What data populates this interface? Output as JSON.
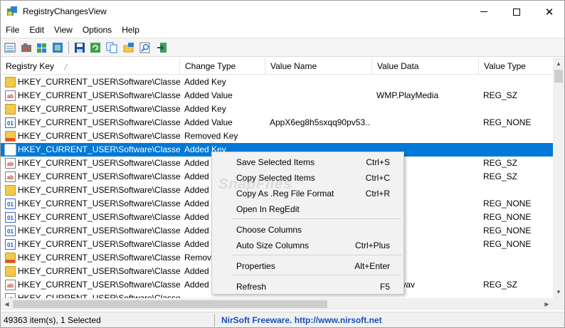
{
  "window": {
    "title": "RegistryChangesView"
  },
  "menu": [
    "File",
    "Edit",
    "View",
    "Options",
    "Help"
  ],
  "toolbar_icons": [
    "report-icon",
    "camera-icon",
    "snapshot-icon",
    "compare-icon",
    "save-icon",
    "refresh-icon",
    "copy-icon",
    "export-reg-icon",
    "find-icon",
    "exit-icon"
  ],
  "columns": [
    "Registry Key",
    "Change Type",
    "Value Name",
    "Value Data",
    "Value Type"
  ],
  "rows": [
    {
      "icon": "folder",
      "key": "HKEY_CURRENT_USER\\Software\\Classes\\...",
      "type": "Added Key",
      "name": "",
      "data": "",
      "vtype": ""
    },
    {
      "icon": "ab",
      "key": "HKEY_CURRENT_USER\\Software\\Classes\\...",
      "type": "Added Value",
      "name": "",
      "data": "WMP.PlayMedia",
      "vtype": "REG_SZ"
    },
    {
      "icon": "folder",
      "key": "HKEY_CURRENT_USER\\Software\\Classes\\...",
      "type": "Added Key",
      "name": "",
      "data": "",
      "vtype": ""
    },
    {
      "icon": "bin",
      "key": "HKEY_CURRENT_USER\\Software\\Classes\\...",
      "type": "Added Value",
      "name": "AppX6eg8h5sxqq90pv53...",
      "data": "",
      "vtype": "REG_NONE"
    },
    {
      "icon": "folder-removed",
      "key": "HKEY_CURRENT_USER\\Software\\Classes\\...",
      "type": "Removed Key",
      "name": "",
      "data": "",
      "vtype": ""
    },
    {
      "icon": "selected",
      "key": "HKEY_CURRENT_USER\\Software\\Classes\\...",
      "type": "Added Key",
      "name": "",
      "data": "",
      "vtype": "",
      "selected": true
    },
    {
      "icon": "ab",
      "key": "HKEY_CURRENT_USER\\Software\\Classes\\...",
      "type": "Added",
      "name": "",
      "data": "",
      "vtype": "REG_SZ"
    },
    {
      "icon": "ab",
      "key": "HKEY_CURRENT_USER\\Software\\Classes\\...",
      "type": "Added",
      "name": "",
      "data": "",
      "vtype": "REG_SZ"
    },
    {
      "icon": "folder",
      "key": "HKEY_CURRENT_USER\\Software\\Classes\\...",
      "type": "Added",
      "name": "",
      "data": "",
      "vtype": ""
    },
    {
      "icon": "bin",
      "key": "HKEY_CURRENT_USER\\Software\\Classes\\...",
      "type": "Added",
      "name": "",
      "data": "",
      "vtype": "REG_NONE"
    },
    {
      "icon": "bin",
      "key": "HKEY_CURRENT_USER\\Software\\Classes\\...",
      "type": "Added",
      "name": "",
      "data": "",
      "vtype": "REG_NONE"
    },
    {
      "icon": "bin",
      "key": "HKEY_CURRENT_USER\\Software\\Classes\\...",
      "type": "Added",
      "name": "",
      "data": "",
      "vtype": "REG_NONE"
    },
    {
      "icon": "bin",
      "key": "HKEY_CURRENT_USER\\Software\\Classes\\...",
      "type": "Added",
      "name": "",
      "data": "",
      "vtype": "REG_NONE"
    },
    {
      "icon": "folder-removed",
      "key": "HKEY_CURRENT_USER\\Software\\Classes\\...",
      "type": "Remov",
      "name": "",
      "data": "",
      "vtype": ""
    },
    {
      "icon": "folder",
      "key": "HKEY_CURRENT_USER\\Software\\Classes\\...",
      "type": "Added",
      "name": "",
      "data": "",
      "vtype": ""
    },
    {
      "icon": "ab",
      "key": "HKEY_CURRENT_USER\\Software\\Classes\\...",
      "type": "Added",
      "name": "",
      "data": "nFile_wav",
      "vtype": "REG_SZ"
    },
    {
      "icon": "ab",
      "key": "HKEY_CURRENT_USER\\Software\\Classes\\...",
      "type": "",
      "name": "",
      "data": "",
      "vtype": ""
    }
  ],
  "context_menu": [
    {
      "label": "Save Selected Items",
      "shortcut": "Ctrl+S"
    },
    {
      "label": "Copy Selected Items",
      "shortcut": "Ctrl+C"
    },
    {
      "label": "Copy As .Reg File Format",
      "shortcut": "Ctrl+R"
    },
    {
      "label": "Open In RegEdit",
      "shortcut": ""
    },
    {
      "separator": true
    },
    {
      "label": "Choose Columns",
      "shortcut": ""
    },
    {
      "label": "Auto Size Columns",
      "shortcut": "Ctrl+Plus"
    },
    {
      "separator": true
    },
    {
      "label": "Properties",
      "shortcut": "Alt+Enter"
    },
    {
      "separator": true
    },
    {
      "label": "Refresh",
      "shortcut": "F5"
    }
  ],
  "watermark": "SnapFiles",
  "status": {
    "count": "49363 item(s), 1 Selected",
    "link": "NirSoft Freeware.  http://www.nirsoft.net"
  },
  "colors": {
    "selection": "#0078d7",
    "link": "#1550b8"
  }
}
